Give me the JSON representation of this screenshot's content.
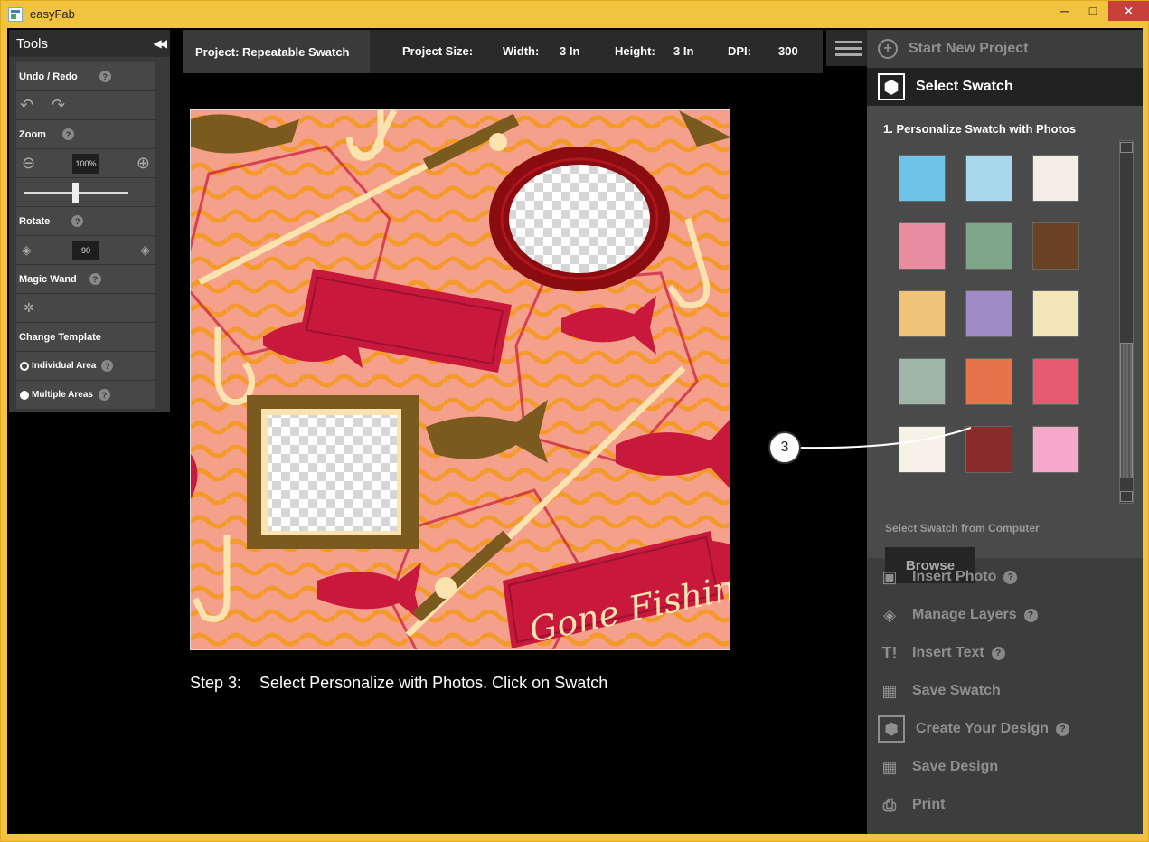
{
  "window": {
    "title": "easyFab",
    "controls": {
      "minimize": "─",
      "maximize": "□",
      "close": "✕"
    }
  },
  "tools": {
    "title": "Tools",
    "undo_redo": "Undo / Redo",
    "zoom": "Zoom",
    "zoom_value": "100%",
    "rotate": "Rotate",
    "rotate_value": "90",
    "magic_wand": "Magic Wand",
    "change_template": "Change Template",
    "individual_area": "Individual Area",
    "multiple_areas": "Multiple Areas",
    "help": "?"
  },
  "project": {
    "name": "Project: Repeatable Swatch",
    "size_label": "Project Size:",
    "width_label": "Width:",
    "width_value": "3 In",
    "height_label": "Height:",
    "height_value": "3 In",
    "dpi_label": "DPI:",
    "dpi_value": "300"
  },
  "canvas": {
    "sign_text": "Gone Fishin’",
    "colors": {
      "bg": "#f4a08a",
      "wave": "#f39a2a",
      "fish": "#c8193c",
      "olive": "#7a5a1e",
      "cream": "#fbe3b0",
      "ring": "#8a0c10"
    }
  },
  "step_text": "Step 3:    Select Personalize with Photos. Click on Swatch",
  "right_panel": {
    "start_new": "Start New Project",
    "select_swatch": "Select Swatch",
    "personalize_heading": "1. Personalize Swatch with Photos",
    "from_computer": "Select Swatch from Computer",
    "browse": "Browse",
    "insert_photo": "Insert Photo",
    "manage_layers": "Manage Layers",
    "insert_text": "Insert Text",
    "save_swatch": "Save Swatch",
    "create_design": "Create Your Design",
    "save_design": "Save Design",
    "print": "Print",
    "help": "?"
  },
  "callout": "3"
}
